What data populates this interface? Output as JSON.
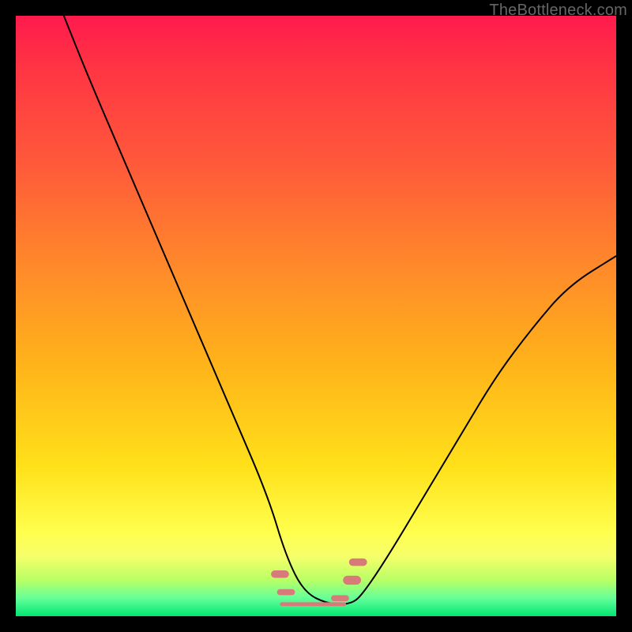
{
  "watermark": "TheBottleneck.com",
  "chart_data": {
    "type": "line",
    "title": "",
    "xlabel": "",
    "ylabel": "",
    "xlim": [
      0,
      100
    ],
    "ylim": [
      0,
      100
    ],
    "series": [
      {
        "name": "bottleneck-curve",
        "x": [
          8,
          12,
          18,
          24,
          30,
          36,
          42,
          45,
          48,
          52,
          56,
          58,
          62,
          68,
          74,
          80,
          86,
          92,
          100
        ],
        "y": [
          100,
          90,
          76,
          62,
          48,
          34,
          20,
          10,
          4,
          2,
          2,
          4,
          10,
          20,
          30,
          40,
          48,
          55,
          60
        ]
      }
    ],
    "annotations": [
      {
        "name": "valley-markers",
        "approx_x_range": [
          44,
          60
        ],
        "approx_y": 2
      }
    ]
  },
  "colors": {
    "curve": "#000000",
    "markers": "#d97a7a",
    "background_top": "#ff1a4d",
    "background_bottom": "#00e673"
  }
}
